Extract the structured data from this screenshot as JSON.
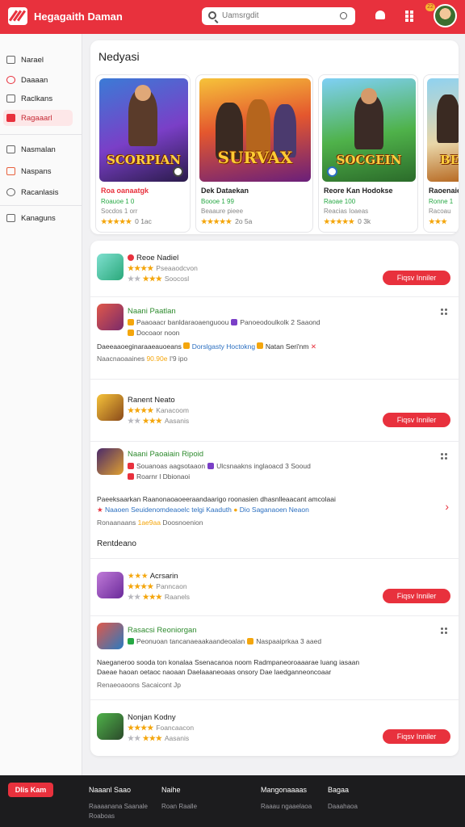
{
  "header": {
    "brand": "Hegagaith Daman",
    "search_placeholder": "Uamsrgdit",
    "badge": "22"
  },
  "sidebar": {
    "items": [
      {
        "label": "Narael",
        "icon": "grid-icon",
        "active": false
      },
      {
        "label": "Daaaan",
        "icon": "circle-icon",
        "active": false
      },
      {
        "label": "Raclkans",
        "icon": "briefcase-icon",
        "active": false
      },
      {
        "label": "Ragaaarl",
        "icon": "square-icon",
        "active": true
      },
      {
        "label": "Nasmalan",
        "icon": "home-icon",
        "active": false
      },
      {
        "label": "Naspans",
        "icon": "box-icon",
        "active": false
      },
      {
        "label": "Racanlasis",
        "icon": "gear-icon",
        "active": false
      },
      {
        "label": "Kanaguns",
        "icon": "folder-icon",
        "active": false
      }
    ]
  },
  "featured": {
    "title": "Nedyasi",
    "cards": [
      {
        "art": "SCORPIAN",
        "name": "Roa oanaatgk",
        "sub": "Roauoe 1 0",
        "sub2": "Socdos 1 orr",
        "stars": "★★★★★",
        "count": "0 1ac"
      },
      {
        "art": "SURVAX",
        "name": "Dek Dataekan",
        "sub": "Boooe 1 99",
        "sub2": "Beaaure pieee",
        "stars": "★★★★★",
        "count": "2o 5a"
      },
      {
        "art": "SOCGEIN",
        "name": "Reore Kan Hodokse",
        "sub": "Raoae 100",
        "sub2": "Reacias Ioaeas",
        "stars": "★★★★★",
        "count": "0 3k"
      },
      {
        "art": "BE",
        "name": "Raoenaie",
        "sub": "Ronne 1",
        "sub2": "Racoau",
        "stars": "★★★",
        "count": ""
      }
    ]
  },
  "apps": [
    {
      "name": "Reoe Nadiel",
      "stars": "★★★★",
      "meta1": "Pseaaodcvon",
      "stars2": "★★★",
      "meta2": "Soocosl",
      "button": "Fiqsv Inniler"
    },
    {
      "name": "Naani Paatlan",
      "line1": "Paaoaacr banldaraoaenguoou",
      "line1b": "Panoeodoulkolk 2 Saaond",
      "line1c": "Docoaor noon",
      "desc": "Daeeaaoeginaraaeauoeans",
      "descb": "Dorslgasty Hoctokng",
      "descc": "Natan Seri'nm",
      "meta": "Naacnaoaaines",
      "meta_b": "90.90e",
      "meta_c": "I'9 ipo"
    },
    {
      "name": "Ranent Neato",
      "stars": "★★★★",
      "meta1": "Kanacoom",
      "stars2": "★★★",
      "meta2": "Aasanis",
      "button": "Fiqsv Inniler"
    },
    {
      "name": "Naani Paoaiain Ripoid",
      "line1": "Souanoas aagsotaaon",
      "line1b": "Ulcsnaakns inglaoacd 3 Sooud",
      "line1c": "Roarnr l Dbionaoi",
      "desc": "Paeeksaarkan Raanonaoaoeeraandaarigo roonasien dhasnlleaacant amcolaai",
      "descb": "Naaoen Seuidenomdeaoelc telgi Kaaduth",
      "descc": "Dio Saganaoen Neaon",
      "meta": "Ronaanaans",
      "meta_b": "1ae9aa",
      "meta_c": "Doosnoenion",
      "footer": "Rentdeano"
    },
    {
      "name": "Acrsarin",
      "stars": "★★★★",
      "meta1": "Panncaon",
      "stars2": "★★★",
      "meta2": "Raanels",
      "button": "Fiqsv Inniler"
    },
    {
      "name": "Rasacsi Reoniorgan",
      "line1": "Peonuoan tancanaeaakaandeoalan",
      "line1b": "Naspaaiprkaa 3 aaed",
      "desc": "Naeganeroo sooda ton konalaa Ssenacanoa noom Radmpaneoroaaarae luang iasaan",
      "descb": "Daeae haoan oetaoc naoaan Daelaaaneoaas onsory Dae laedganneoncoaar",
      "meta": "Renaeoaoons",
      "meta_b": "Sacaicont Jp"
    },
    {
      "name": "Nonjan Kodny",
      "stars": "★★★★",
      "meta1": "Foancaacon",
      "stars2": "★★★",
      "meta2": "Aasanis",
      "button": "Fiqsv Inniler"
    }
  ],
  "footer": {
    "logo": "Dlis Kam",
    "cols": [
      {
        "head": "Naaanl Saao",
        "l1": "Raaaanana Saanale",
        "l2": "Roaboas"
      },
      {
        "head": "Naihe",
        "l1": "Roan Raalle",
        "l2": ""
      },
      {
        "head": "Mangonaaaas",
        "l1": "Raaau ngaaelaoa",
        "l2": ""
      },
      {
        "head": "Bagaa",
        "l1": "Daaahaoa",
        "l2": ""
      }
    ]
  },
  "colors": {
    "accent": "#e8313d",
    "star": "#f4a60d",
    "green": "#27a844",
    "link": "#2b6fc0"
  }
}
